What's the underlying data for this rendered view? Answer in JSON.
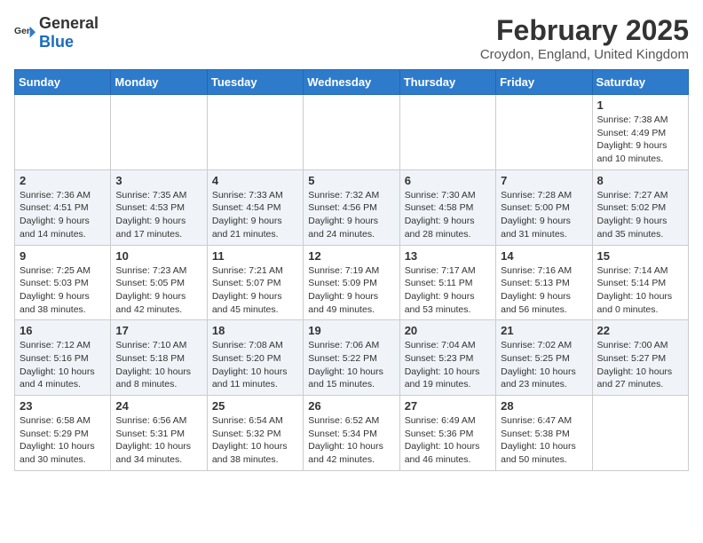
{
  "header": {
    "logo_general": "General",
    "logo_blue": "Blue",
    "title": "February 2025",
    "subtitle": "Croydon, England, United Kingdom"
  },
  "weekdays": [
    "Sunday",
    "Monday",
    "Tuesday",
    "Wednesday",
    "Thursday",
    "Friday",
    "Saturday"
  ],
  "weeks": [
    [
      {
        "day": "",
        "info": ""
      },
      {
        "day": "",
        "info": ""
      },
      {
        "day": "",
        "info": ""
      },
      {
        "day": "",
        "info": ""
      },
      {
        "day": "",
        "info": ""
      },
      {
        "day": "",
        "info": ""
      },
      {
        "day": "1",
        "info": "Sunrise: 7:38 AM\nSunset: 4:49 PM\nDaylight: 9 hours and 10 minutes."
      }
    ],
    [
      {
        "day": "2",
        "info": "Sunrise: 7:36 AM\nSunset: 4:51 PM\nDaylight: 9 hours and 14 minutes."
      },
      {
        "day": "3",
        "info": "Sunrise: 7:35 AM\nSunset: 4:53 PM\nDaylight: 9 hours and 17 minutes."
      },
      {
        "day": "4",
        "info": "Sunrise: 7:33 AM\nSunset: 4:54 PM\nDaylight: 9 hours and 21 minutes."
      },
      {
        "day": "5",
        "info": "Sunrise: 7:32 AM\nSunset: 4:56 PM\nDaylight: 9 hours and 24 minutes."
      },
      {
        "day": "6",
        "info": "Sunrise: 7:30 AM\nSunset: 4:58 PM\nDaylight: 9 hours and 28 minutes."
      },
      {
        "day": "7",
        "info": "Sunrise: 7:28 AM\nSunset: 5:00 PM\nDaylight: 9 hours and 31 minutes."
      },
      {
        "day": "8",
        "info": "Sunrise: 7:27 AM\nSunset: 5:02 PM\nDaylight: 9 hours and 35 minutes."
      }
    ],
    [
      {
        "day": "9",
        "info": "Sunrise: 7:25 AM\nSunset: 5:03 PM\nDaylight: 9 hours and 38 minutes."
      },
      {
        "day": "10",
        "info": "Sunrise: 7:23 AM\nSunset: 5:05 PM\nDaylight: 9 hours and 42 minutes."
      },
      {
        "day": "11",
        "info": "Sunrise: 7:21 AM\nSunset: 5:07 PM\nDaylight: 9 hours and 45 minutes."
      },
      {
        "day": "12",
        "info": "Sunrise: 7:19 AM\nSunset: 5:09 PM\nDaylight: 9 hours and 49 minutes."
      },
      {
        "day": "13",
        "info": "Sunrise: 7:17 AM\nSunset: 5:11 PM\nDaylight: 9 hours and 53 minutes."
      },
      {
        "day": "14",
        "info": "Sunrise: 7:16 AM\nSunset: 5:13 PM\nDaylight: 9 hours and 56 minutes."
      },
      {
        "day": "15",
        "info": "Sunrise: 7:14 AM\nSunset: 5:14 PM\nDaylight: 10 hours and 0 minutes."
      }
    ],
    [
      {
        "day": "16",
        "info": "Sunrise: 7:12 AM\nSunset: 5:16 PM\nDaylight: 10 hours and 4 minutes."
      },
      {
        "day": "17",
        "info": "Sunrise: 7:10 AM\nSunset: 5:18 PM\nDaylight: 10 hours and 8 minutes."
      },
      {
        "day": "18",
        "info": "Sunrise: 7:08 AM\nSunset: 5:20 PM\nDaylight: 10 hours and 11 minutes."
      },
      {
        "day": "19",
        "info": "Sunrise: 7:06 AM\nSunset: 5:22 PM\nDaylight: 10 hours and 15 minutes."
      },
      {
        "day": "20",
        "info": "Sunrise: 7:04 AM\nSunset: 5:23 PM\nDaylight: 10 hours and 19 minutes."
      },
      {
        "day": "21",
        "info": "Sunrise: 7:02 AM\nSunset: 5:25 PM\nDaylight: 10 hours and 23 minutes."
      },
      {
        "day": "22",
        "info": "Sunrise: 7:00 AM\nSunset: 5:27 PM\nDaylight: 10 hours and 27 minutes."
      }
    ],
    [
      {
        "day": "23",
        "info": "Sunrise: 6:58 AM\nSunset: 5:29 PM\nDaylight: 10 hours and 30 minutes."
      },
      {
        "day": "24",
        "info": "Sunrise: 6:56 AM\nSunset: 5:31 PM\nDaylight: 10 hours and 34 minutes."
      },
      {
        "day": "25",
        "info": "Sunrise: 6:54 AM\nSunset: 5:32 PM\nDaylight: 10 hours and 38 minutes."
      },
      {
        "day": "26",
        "info": "Sunrise: 6:52 AM\nSunset: 5:34 PM\nDaylight: 10 hours and 42 minutes."
      },
      {
        "day": "27",
        "info": "Sunrise: 6:49 AM\nSunset: 5:36 PM\nDaylight: 10 hours and 46 minutes."
      },
      {
        "day": "28",
        "info": "Sunrise: 6:47 AM\nSunset: 5:38 PM\nDaylight: 10 hours and 50 minutes."
      },
      {
        "day": "",
        "info": ""
      }
    ]
  ]
}
